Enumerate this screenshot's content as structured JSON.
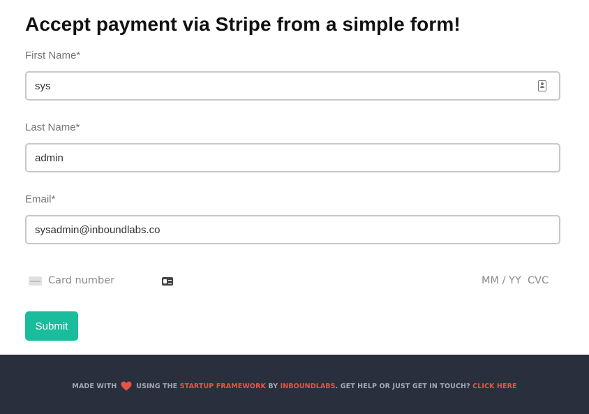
{
  "page": {
    "title": "Accept payment via Stripe from a simple form!"
  },
  "form": {
    "first_name": {
      "label": "First Name*",
      "value": "sys"
    },
    "last_name": {
      "label": "Last Name*",
      "value": "admin"
    },
    "email": {
      "label": "Email*",
      "value": "sysadmin@inboundlabs.co"
    },
    "card": {
      "number_placeholder": "Card number",
      "expiry_placeholder": "MM / YY",
      "cvc_placeholder": "CVC"
    },
    "submit_label": "Submit"
  },
  "footer": {
    "made_with": "MADE WITH",
    "using_the": "USING THE",
    "framework_link": "STARTUP FRAMEWORK",
    "by": "BY",
    "company_link": "INBOUNDLABS",
    "help_text": ". GET HELP OR JUST GET IN TOUCH?",
    "click_here_link": "CLICK HERE"
  },
  "colors": {
    "accent": "#1abc9c",
    "footer_bg": "#2a2f3e",
    "footer_link": "#e8553f",
    "heart": "#e8553f"
  },
  "icons": {
    "autofill": "contact-card-icon",
    "card_brand": "credit-card-icon",
    "card_autofill": "card-autofill-icon",
    "heart": "heart-icon"
  }
}
